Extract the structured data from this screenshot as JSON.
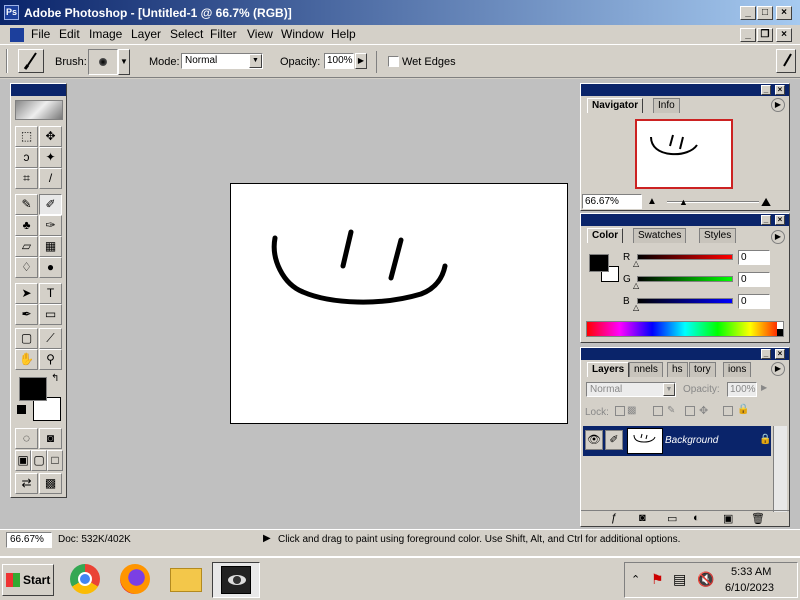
{
  "window": {
    "title": "Adobe Photoshop - [Untitled-1 @ 66.7% (RGB)]",
    "app_icon": "Ps"
  },
  "menu": [
    "File",
    "Edit",
    "Image",
    "Layer",
    "Select",
    "Filter",
    "View",
    "Window",
    "Help"
  ],
  "options_bar": {
    "brush_label": "Brush:",
    "mode_label": "Mode:",
    "mode_value": "Normal",
    "opacity_label": "Opacity:",
    "opacity_value": "100%",
    "wet_edges_label": "Wet Edges",
    "wet_edges_checked": false
  },
  "navigator": {
    "tabs": [
      "Navigator",
      "Info"
    ],
    "zoom": "66.67%"
  },
  "color": {
    "tabs": [
      "Color",
      "Swatches",
      "Styles"
    ],
    "channels": [
      {
        "name": "R",
        "value": "0",
        "color": "#c00000"
      },
      {
        "name": "G",
        "value": "0",
        "color": "#00a000"
      },
      {
        "name": "B",
        "value": "0",
        "color": "#0000c0"
      }
    ],
    "foreground": "#000000",
    "background": "#ffffff"
  },
  "layers": {
    "tabs": [
      "Layers",
      "nnels",
      "hs",
      "tory",
      "ions"
    ],
    "blend_mode": "Normal",
    "opacity_label": "Opacity:",
    "opacity_value": "100%",
    "lock_label": "Lock:",
    "layer_name": "Background"
  },
  "status": {
    "zoom": "66.67%",
    "doc": "Doc: 532K/402K",
    "message": "Click and drag to paint using foreground color.  Use Shift, Alt, and Ctrl for additional options."
  },
  "taskbar": {
    "start_label": "Start",
    "time": "5:33 AM",
    "date": "6/10/2023"
  }
}
